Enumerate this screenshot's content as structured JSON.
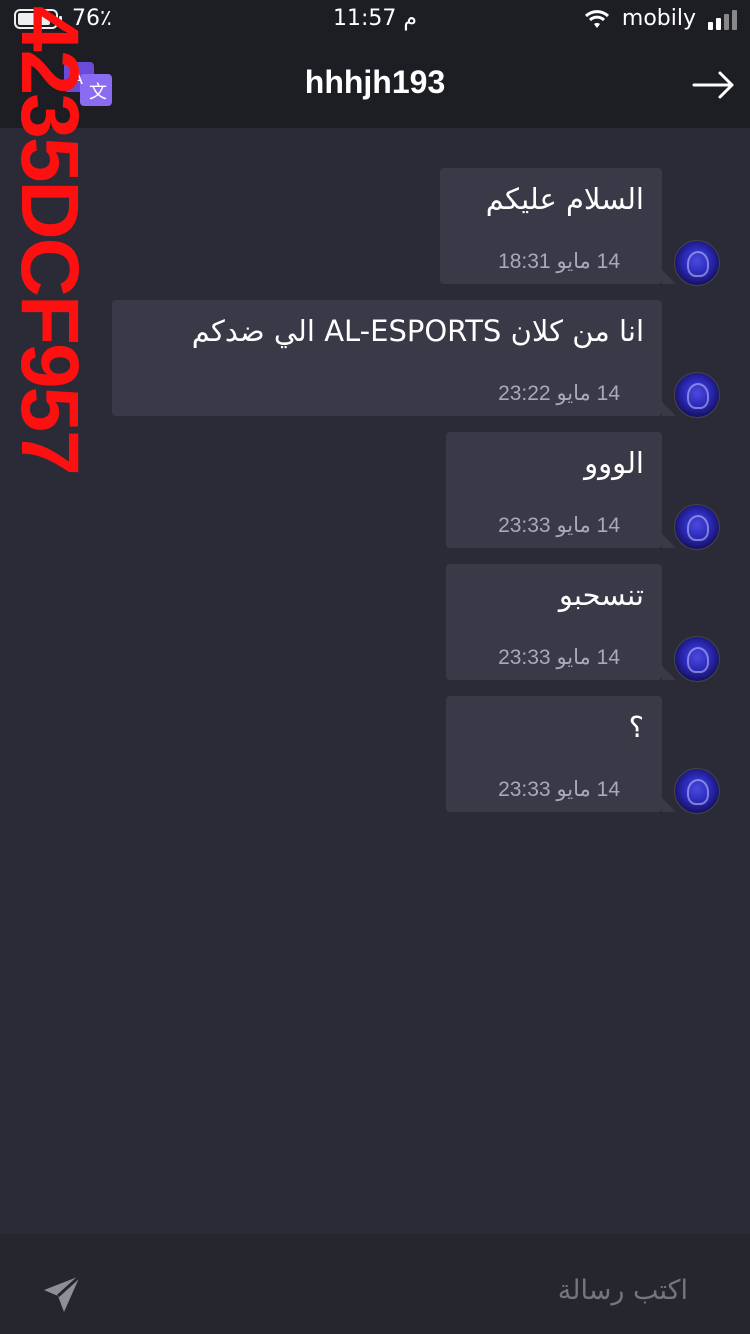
{
  "status_bar": {
    "battery": "76٪",
    "time": "11:57 م",
    "carrier": "mobily"
  },
  "header": {
    "title": "hhhjh193",
    "translate_icon": "translate-icon",
    "back_icon": "arrow-right-icon"
  },
  "watermark": "4235DCF957",
  "messages": [
    {
      "text": "السلام عليكم",
      "time": "14 مايو 18:31"
    },
    {
      "text": "انا من كلان AL-ESPORTS الي ضدكم",
      "time": "14 مايو 23:22"
    },
    {
      "text": "الووو",
      "time": "14 مايو 23:33"
    },
    {
      "text": "تنسحبو",
      "time": "14 مايو 23:33"
    },
    {
      "text": "؟",
      "time": "14 مايو 23:33"
    }
  ],
  "composer": {
    "placeholder": "اكتب رسالة",
    "send_icon": "send-icon"
  },
  "colors": {
    "background": "#2b2b37",
    "bar": "#1d1d24",
    "bubble": "#393948",
    "accent": "#7c5cf0",
    "watermark": "#ff1010"
  }
}
